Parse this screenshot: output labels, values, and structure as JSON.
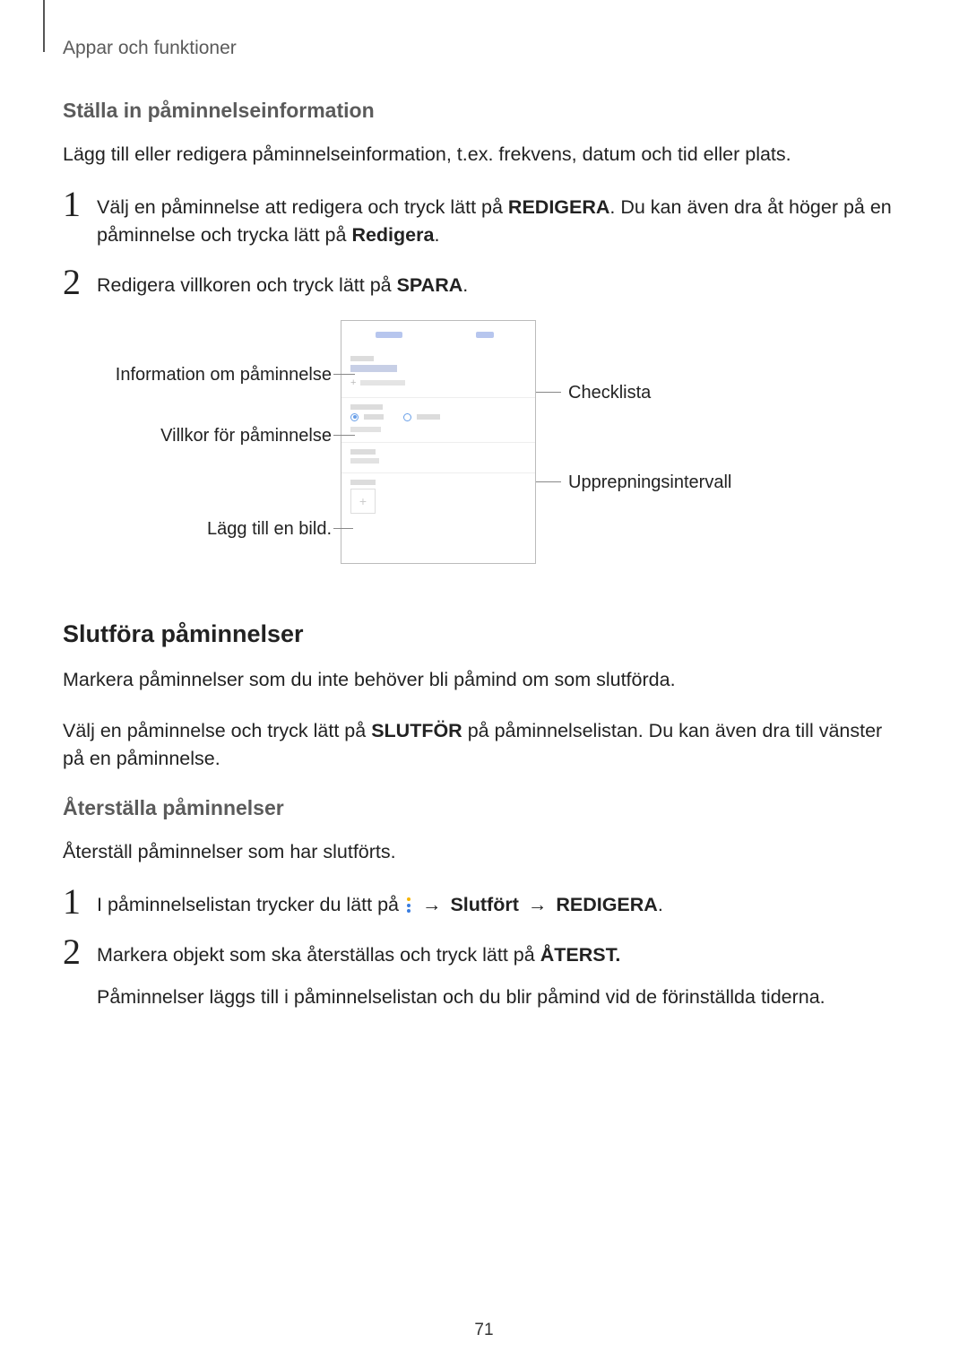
{
  "breadcrumb": "Appar och funktioner",
  "section1": {
    "title": "Ställa in påminnelseinformation",
    "intro": "Lägg till eller redigera påminnelseinformation, t.ex. frekvens, datum och tid eller plats.",
    "step1_a": "Välj en påminnelse att redigera och tryck lätt på ",
    "step1_b": "REDIGERA",
    "step1_c": ". Du kan även dra åt höger på en påminnelse och trycka lätt på ",
    "step1_d": "Redigera",
    "step1_e": ".",
    "step2_a": "Redigera villkoren och tryck lätt på ",
    "step2_b": "SPARA",
    "step2_c": "."
  },
  "callouts": {
    "left1": "Information om påminnelse",
    "left2": "Villkor för påminnelse",
    "left3": "Lägg till en bild.",
    "right1": "Checklista",
    "right2": "Upprepningsintervall"
  },
  "section2": {
    "title": "Slutföra påminnelser",
    "p1": "Markera påminnelser som du inte behöver bli påmind om som slutförda.",
    "p2_a": "Välj en påminnelse och tryck lätt på ",
    "p2_b": "SLUTFÖR",
    "p2_c": " på påminnelselistan. Du kan även dra till vänster på en påminnelse."
  },
  "section3": {
    "title": "Återställa påminnelser",
    "intro": "Återställ påminnelser som har slutförts.",
    "step1_a": "I påminnelselistan trycker du lätt på ",
    "step1_b": " → ",
    "step1_c": "Slutfört",
    "step1_d": " → ",
    "step1_e": "REDIGERA",
    "step1_f": ".",
    "step2_a": "Markera objekt som ska återställas och tryck lätt på ",
    "step2_b": "ÅTERST.",
    "step2_sub": "Påminnelser läggs till i påminnelselistan och du blir påmind vid de förinställda tiderna."
  },
  "page_number": "71"
}
